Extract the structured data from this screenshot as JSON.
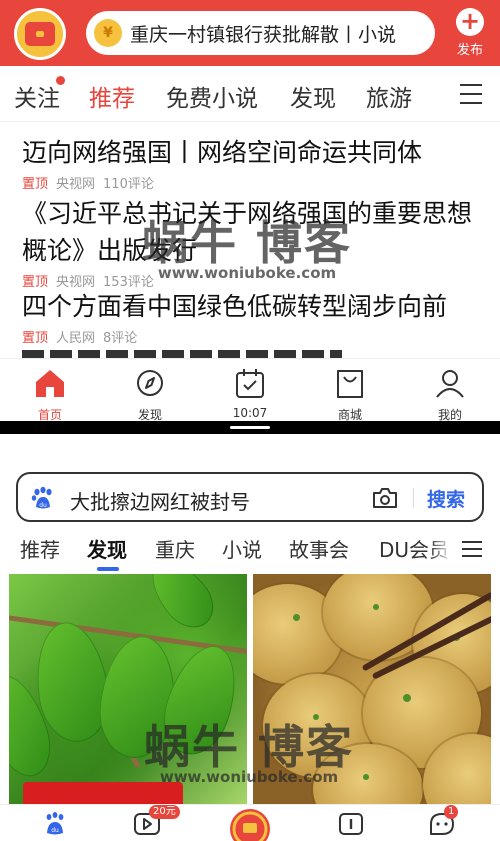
{
  "news_app": {
    "search_hint": "重庆一村镇银行获批解散丨小说",
    "coin_glyph": "¥",
    "publish_label": "发布",
    "tabs": [
      "关注",
      "推荐",
      "免费小说",
      "发现",
      "旅游"
    ],
    "active_tab": "推荐",
    "articles": [
      {
        "title": "迈向网络强国丨网络空间命运共同体",
        "pin": "置顶",
        "source": "央视网",
        "comments": "110评论"
      },
      {
        "title": "《习近平总书记关于网络强国的重要思想概论》出版发行",
        "pin": "置顶",
        "source": "央视网",
        "comments": "153评论"
      },
      {
        "title": "四个方面看中国绿色低碳转型阔步向前",
        "pin": "置顶",
        "source": "人民网",
        "comments": "8评论"
      }
    ],
    "bottom_nav": [
      "首页",
      "发现",
      "10:07",
      "商城",
      "我的"
    ]
  },
  "baidu_app": {
    "search_query": "大批擦边网红被封号",
    "search_button": "搜索",
    "tabs": [
      "推荐",
      "发现",
      "重庆",
      "小说",
      "故事会",
      "DU会员"
    ],
    "active_tab": "发现",
    "nav_badges": {
      "video": "20元",
      "messages": "1"
    }
  },
  "watermark": {
    "text": "蜗牛 博客",
    "url": "www.woniuboke.com"
  },
  "colors": {
    "brand_red": "#e8453c",
    "baidu_blue": "#3366e8",
    "coin_gold": "#f6c23d"
  }
}
